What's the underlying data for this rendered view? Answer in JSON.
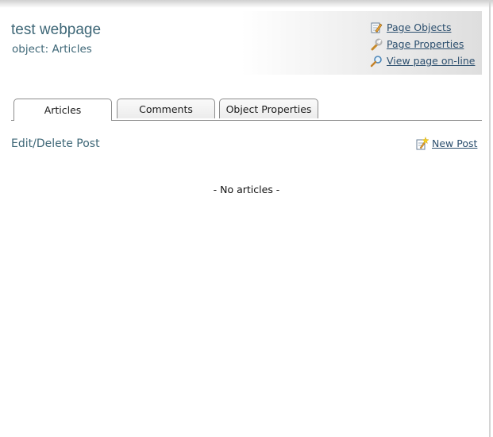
{
  "header": {
    "title": "test webpage",
    "subtitle": "object: Articles",
    "links": [
      {
        "label": "Page Objects",
        "icon": "edit-icon"
      },
      {
        "label": "Page Properties",
        "icon": "wrench-icon"
      },
      {
        "label": "View page on-line",
        "icon": "magnifier-icon"
      }
    ]
  },
  "tabs": [
    {
      "label": "Articles",
      "active": true
    },
    {
      "label": "Comments",
      "active": false
    },
    {
      "label": "Object Properties",
      "active": false
    }
  ],
  "main": {
    "section_title": "Edit/Delete Post",
    "new_post_label": "New Post",
    "empty_message": "- No articles -"
  }
}
